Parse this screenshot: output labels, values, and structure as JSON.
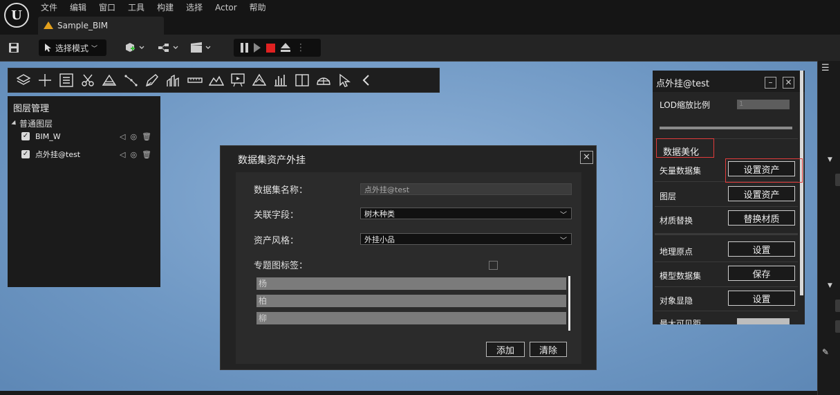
{
  "app": {
    "menu": [
      "文件",
      "编辑",
      "窗口",
      "工具",
      "构建",
      "选择",
      "Actor",
      "帮助"
    ],
    "tab_title": "Sample_BIM",
    "mode_label": "选择模式",
    "logo": "unreal-logo"
  },
  "layer_panel": {
    "title": "图层管理",
    "group": "普通图层",
    "items": [
      {
        "label": "BIM_W",
        "checked": true
      },
      {
        "label": "点外挂@test",
        "checked": true
      }
    ]
  },
  "dialog": {
    "title": "数据集资产外挂",
    "fields": {
      "dataset_name_label": "数据集名称：",
      "dataset_name_value": "点外挂@test",
      "link_field_label": "关联字段：",
      "link_field_value": "树木种类",
      "asset_style_label": "资产风格：",
      "asset_style_value": "外挂小品",
      "topic_tag_label": "专题图标签："
    },
    "tags": [
      "杨",
      "柏",
      "柳"
    ],
    "add_label": "添加",
    "clear_label": "清除"
  },
  "right_panel": {
    "title": "点外挂@test",
    "lod_label": "LOD缩放比例",
    "lod_value": "1",
    "section_title": "数据美化",
    "rows": [
      {
        "label": "矢量数据集",
        "button": "设置资产"
      },
      {
        "label": "图层",
        "button": "设置资产"
      },
      {
        "label": "材质替换",
        "button": "替换材质"
      },
      {
        "label": "地理原点",
        "button": "设置"
      },
      {
        "label": "模型数据集",
        "button": "保存"
      },
      {
        "label": "对象显隐",
        "button": "设置"
      },
      {
        "label": "最大可见距",
        "button": ""
      }
    ]
  },
  "colors": {
    "highlight": "#e23b3b",
    "stop": "#e02121",
    "viewport": "#7aa0c9"
  }
}
